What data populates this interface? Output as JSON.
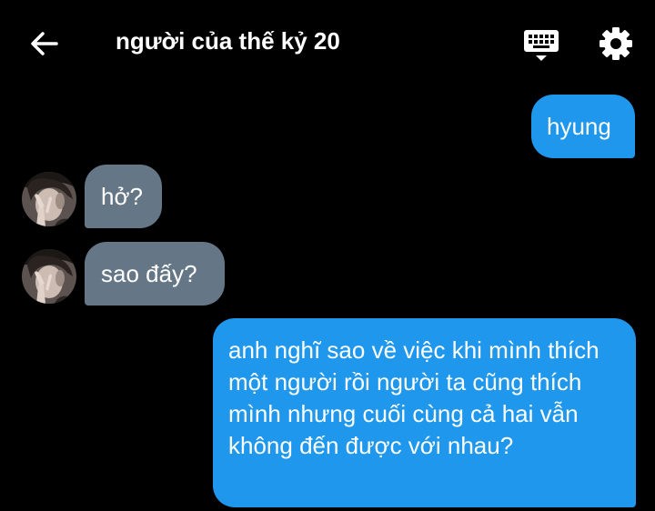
{
  "header": {
    "back_icon": "arrow-left-icon",
    "title": "người của thế kỷ 20",
    "keyboard_icon": "keyboard-icon",
    "settings_icon": "gear-icon"
  },
  "colors": {
    "background": "#000000",
    "outgoing_bubble": "#1e97ec",
    "incoming_bubble": "#657786",
    "text": "#ffffff"
  },
  "messages": [
    {
      "direction": "outgoing",
      "text": "hyung"
    },
    {
      "direction": "incoming",
      "text": "hở?"
    },
    {
      "direction": "incoming",
      "text": "sao đấy?"
    },
    {
      "direction": "outgoing",
      "text": "anh nghĩ sao về việc khi mình thích một người rồi người ta cũng thích mình nhưng cuối cùng cả hai vẫn không đến được với nhau?"
    }
  ]
}
